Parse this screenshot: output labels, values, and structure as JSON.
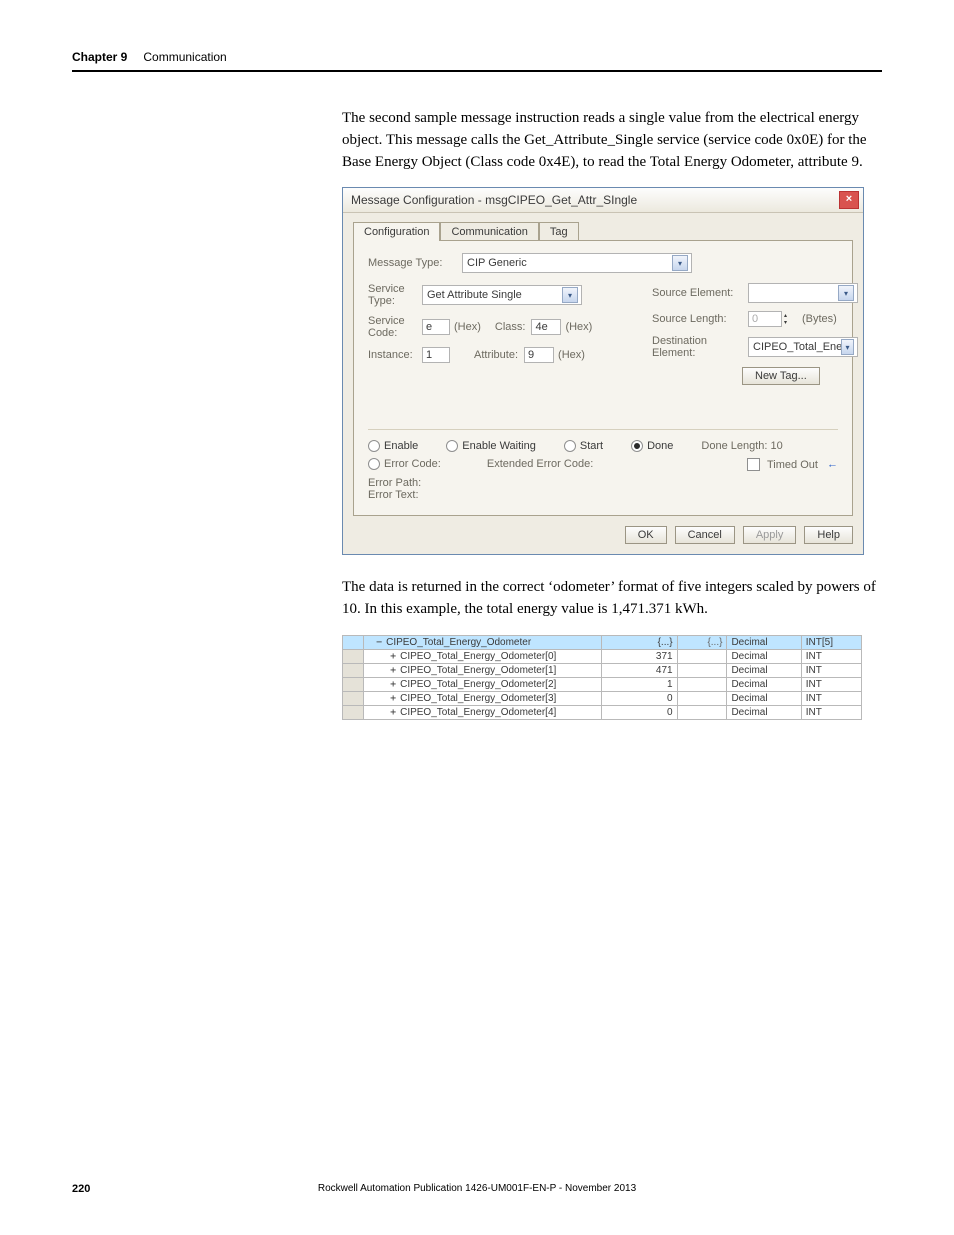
{
  "header": {
    "chapter": "Chapter 9",
    "title": "Communication"
  },
  "paragraph1": "The second sample message instruction reads a single value from the electrical energy object. This message calls the Get_Attribute_Single service (service code 0x0E) for the Base Energy Object (Class code 0x4E), to read the Total Energy Odometer, attribute 9.",
  "dialog": {
    "title": "Message Configuration - msgCIPEO_Get_Attr_SIngle",
    "tabs": [
      "Configuration",
      "Communication",
      "Tag"
    ],
    "message_type_label": "Message Type:",
    "message_type_value": "CIP Generic",
    "service_type_label": "Service Type:",
    "service_type_value": "Get Attribute Single",
    "service_code_label": "Service Code:",
    "service_code_value": "e",
    "hex": "(Hex)",
    "class_label": "Class:",
    "class_value": "4e",
    "instance_label": "Instance:",
    "instance_value": "1",
    "attribute_label": "Attribute:",
    "attribute_value": "9",
    "source_element_label": "Source Element:",
    "source_length_label": "Source Length:",
    "source_length_value": "0",
    "bytes": "(Bytes)",
    "destination_label": "Destination Element:",
    "destination_value": "CIPEO_Total_Energy_",
    "new_tag_btn": "New Tag...",
    "status": {
      "enable": "Enable",
      "enable_waiting": "Enable Waiting",
      "start": "Start",
      "done": "Done",
      "done_length": "Done Length: 10"
    },
    "error_code_label": "Error Code:",
    "extended_error_label": "Extended Error Code:",
    "timed_out_label": "Timed Out",
    "error_path_label": "Error Path:",
    "error_text_label": "Error Text:",
    "buttons": {
      "ok": "OK",
      "cancel": "Cancel",
      "apply": "Apply",
      "help": "Help"
    }
  },
  "paragraph2": "The data is returned in the correct ‘odometer’ format of five integers scaled by powers of 10. In this example, the total energy value is 1,471.371 kWh.",
  "tag_table": {
    "ellipsis": "{...}",
    "rows": [
      {
        "name": "CIPEO_Total_Energy_Odometer",
        "val": "{...}",
        "force": "{...}",
        "style": "Decimal",
        "type": "INT[5]",
        "prefix": "−",
        "selected": true,
        "indent": 0
      },
      {
        "name": "CIPEO_Total_Energy_Odometer[0]",
        "val": "371",
        "force": "",
        "style": "Decimal",
        "type": "INT",
        "prefix": "+",
        "indent": 1
      },
      {
        "name": "CIPEO_Total_Energy_Odometer[1]",
        "val": "471",
        "force": "",
        "style": "Decimal",
        "type": "INT",
        "prefix": "+",
        "indent": 1
      },
      {
        "name": "CIPEO_Total_Energy_Odometer[2]",
        "val": "1",
        "force": "",
        "style": "Decimal",
        "type": "INT",
        "prefix": "+",
        "indent": 1
      },
      {
        "name": "CIPEO_Total_Energy_Odometer[3]",
        "val": "0",
        "force": "",
        "style": "Decimal",
        "type": "INT",
        "prefix": "+",
        "indent": 1
      },
      {
        "name": "CIPEO_Total_Energy_Odometer[4]",
        "val": "0",
        "force": "",
        "style": "Decimal",
        "type": "INT",
        "prefix": "+",
        "indent": 1
      }
    ]
  },
  "footer": {
    "page": "220",
    "publication": "Rockwell Automation Publication 1426-UM001F-EN-P - November 2013"
  }
}
